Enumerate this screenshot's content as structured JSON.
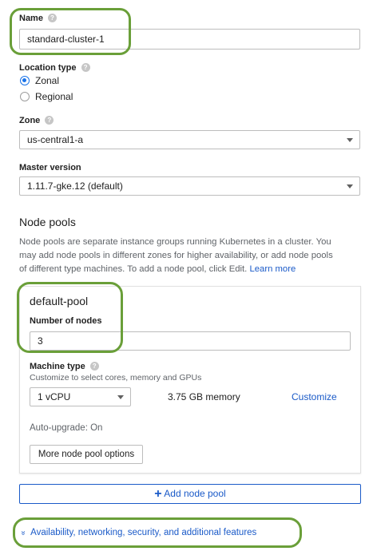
{
  "name": {
    "label": "Name",
    "value": "standard-cluster-1"
  },
  "location": {
    "label": "Location type",
    "options": [
      "Zonal",
      "Regional"
    ],
    "selected": "Zonal"
  },
  "zone": {
    "label": "Zone",
    "value": "us-central1-a"
  },
  "master": {
    "label": "Master version",
    "value": "1.11.7-gke.12 (default)"
  },
  "node_pools": {
    "heading": "Node pools",
    "desc_lines": [
      "Node pools are separate instance groups running Kubernetes in a cluster. You",
      "may add node pools in different zones for higher availability, or add node pools",
      "of different type machines. To add a node pool, click Edit."
    ],
    "learn_more": "Learn more"
  },
  "pool": {
    "title": "default-pool",
    "nodes_label": "Number of nodes",
    "nodes_value": "3",
    "machine_label": "Machine type",
    "machine_hint": "Customize to select cores, memory and GPUs",
    "machine_value": "1 vCPU",
    "memory": "3.75 GB memory",
    "customize": "Customize",
    "autoupgrade": "Auto-upgrade: On",
    "more_options": "More node pool options"
  },
  "add_pool": "Add node pool",
  "advanced": "Availability, networking, security, and additional features",
  "icons": {
    "help": "help-icon",
    "dropdown": "dropdown-caret-icon",
    "add": "plus-icon",
    "expand": "double-chevron-down-icon"
  },
  "colors": {
    "accent": "#1a73e8",
    "highlight_ring": "#6a9f39"
  }
}
